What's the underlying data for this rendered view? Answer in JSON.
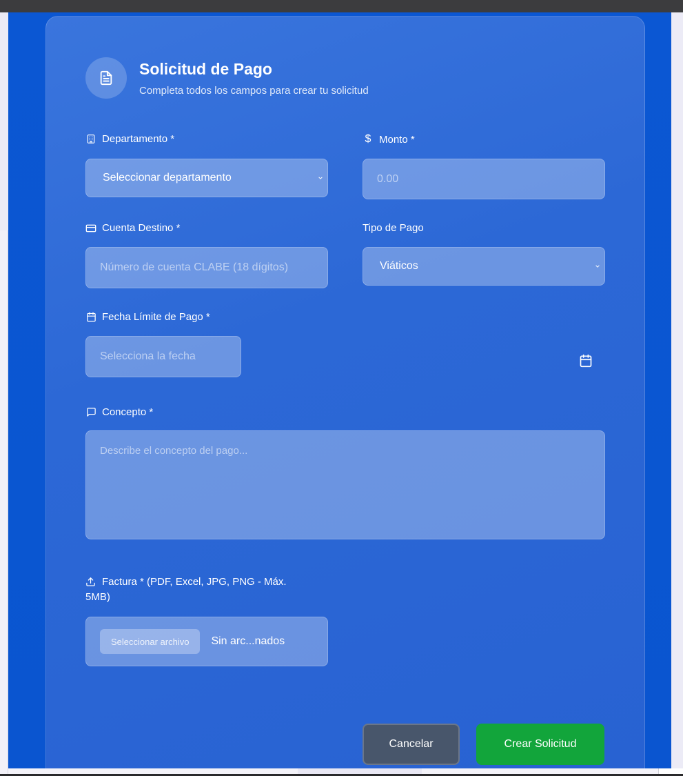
{
  "header": {
    "icon": "document-icon",
    "title": "Solicitud de Pago",
    "subtitle": "Completa todos los campos para crear tu solicitud"
  },
  "fields": {
    "departamento": {
      "icon": "building-icon",
      "label": "Departamento *",
      "value": "Seleccionar departamento"
    },
    "monto": {
      "icon": "dollar-icon",
      "label_icon_text": "$",
      "label": "Monto *",
      "placeholder": "0.00"
    },
    "cuenta": {
      "icon": "credit-card-icon",
      "label": "Cuenta Destino *",
      "placeholder": "Número de cuenta CLABE (18 dígitos)"
    },
    "tipo": {
      "label": "Tipo de Pago",
      "value": "Viáticos"
    },
    "fecha": {
      "icon": "calendar-icon",
      "label": "Fecha Límite de Pago *",
      "placeholder": "Selecciona la fecha"
    },
    "concepto": {
      "icon": "message-icon",
      "label": "Concepto *",
      "placeholder": "Describe el concepto del pago..."
    },
    "factura": {
      "icon": "upload-icon",
      "label_line1": "Factura * (PDF, Excel, JPG, PNG - Máx.",
      "label_line2": "5MB)",
      "button": "Seleccionar archivo",
      "file_status": "Sin arc...nados"
    }
  },
  "actions": {
    "cancel": "Cancelar",
    "submit": "Crear Solicitud"
  },
  "colors": {
    "backdrop": "#0b57d3",
    "card": "#2c68d6",
    "cancel": "#48566b",
    "submit": "#12a53b"
  }
}
